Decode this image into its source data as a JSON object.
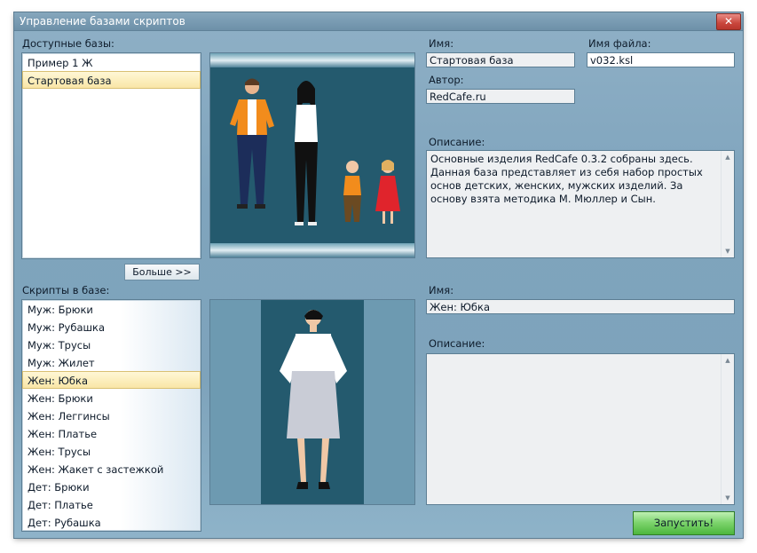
{
  "window": {
    "title": "Управление базами скриптов",
    "close_glyph": "✕"
  },
  "bases": {
    "label": "Доступные базы:",
    "items": [
      "Пример 1 Ж",
      "Стартовая база"
    ],
    "selected": "Стартовая база",
    "more_button": "Больше >>"
  },
  "base_info": {
    "name_label": "Имя:",
    "name_value": "Стартовая база",
    "filename_label": "Имя файла:",
    "filename_value": "v032.ksl",
    "author_label": "Автор:",
    "author_value": "RedCafe.ru",
    "description_label": "Описание:",
    "description_value": "Основные изделия RedCafe 0.3.2 собраны здесь. Данная база представляет из себя набор простых основ детских, женских, мужских изделий. За основу взята методика М. Мюллер и Сын."
  },
  "scripts": {
    "label": "Скрипты в базе:",
    "items": [
      "Муж: Брюки",
      "Муж: Рубашка",
      "Муж: Трусы",
      "Муж: Жилет",
      "Жен: Юбка",
      "Жен: Брюки",
      "Жен: Леггинсы",
      "Жен: Платье",
      "Жен: Трусы",
      "Жен: Жакет с застежкой",
      "Дет: Брюки",
      "Дет: Платье",
      "Дет: Рубашка"
    ],
    "selected": "Жен: Юбка"
  },
  "script_info": {
    "name_label": "Имя:",
    "name_value": "Жен: Юбка",
    "description_label": "Описание:",
    "description_value": ""
  },
  "run_button": "Запустить!",
  "icons": {
    "scroll_up": "▲",
    "scroll_down": "▼"
  },
  "colors": {
    "accent_selection": "#f9e6a6",
    "run_button": "#4cb63d",
    "preview_bg": "#275d72"
  }
}
